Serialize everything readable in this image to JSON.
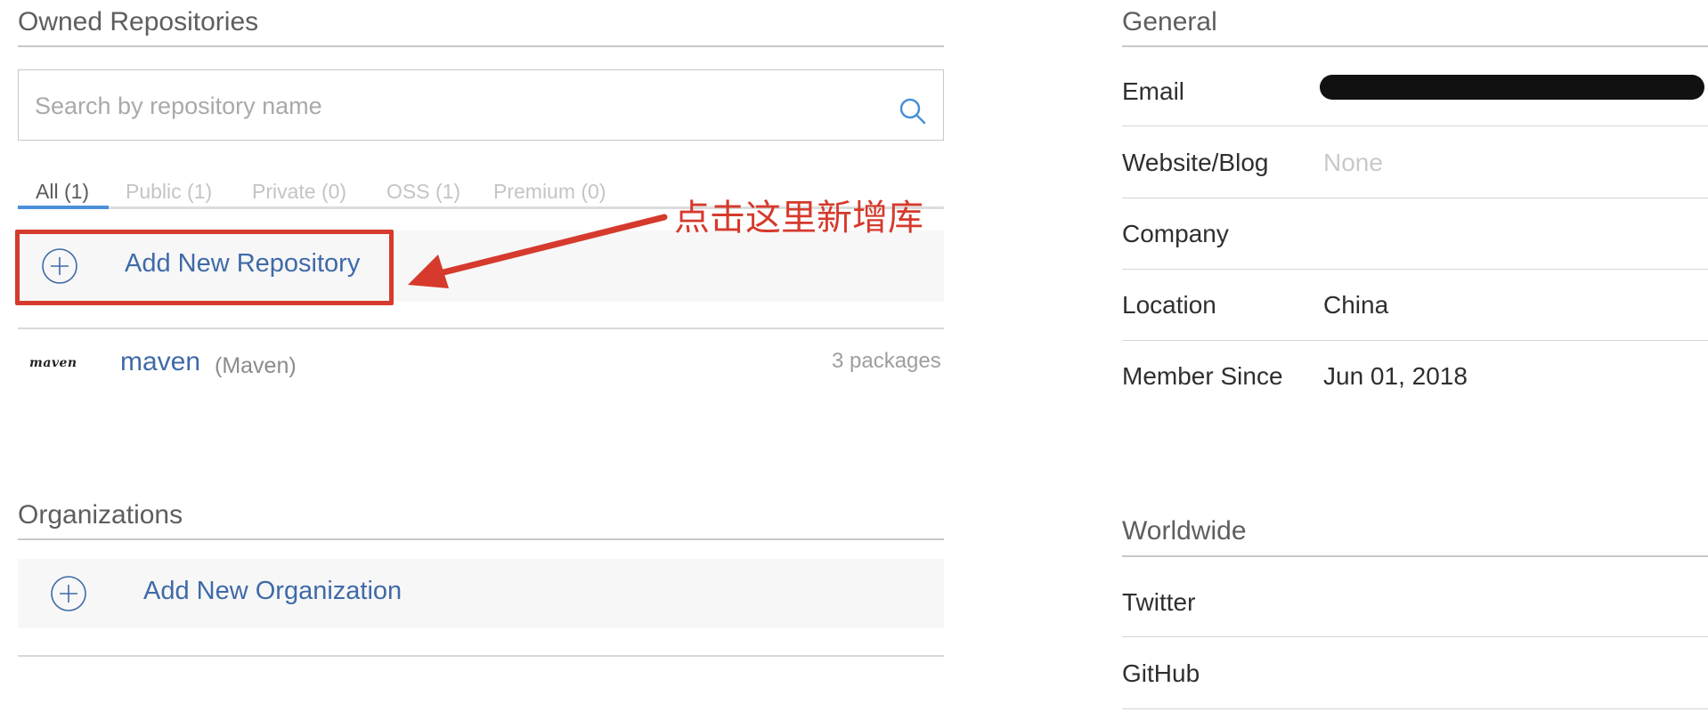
{
  "owned": {
    "title": "Owned Repositories",
    "search_placeholder": "Search by repository name",
    "tabs": [
      {
        "label": "All (1)",
        "active": true
      },
      {
        "label": "Public (1)",
        "active": false
      },
      {
        "label": "Private (0)",
        "active": false
      },
      {
        "label": "OSS (1)",
        "active": false
      },
      {
        "label": "Premium (0)",
        "active": false
      }
    ],
    "add_label": "Add New Repository",
    "repos": [
      {
        "logo": "maven",
        "name": "maven",
        "type": "(Maven)",
        "packages": "3 packages"
      }
    ]
  },
  "annotation": {
    "text": "点击这里新增库",
    "color": "#d53a2c"
  },
  "organizations": {
    "title": "Organizations",
    "add_label": "Add New Organization"
  },
  "general": {
    "title": "General",
    "fields": [
      {
        "label": "Email",
        "value": "",
        "redacted": true
      },
      {
        "label": "Website/Blog",
        "value": "None"
      },
      {
        "label": "Company",
        "value": ""
      },
      {
        "label": "Location",
        "value": "China"
      },
      {
        "label": "Member Since",
        "value": "Jun 01, 2018"
      }
    ]
  },
  "worldwide": {
    "title": "Worldwide",
    "fields": [
      {
        "label": "Twitter"
      },
      {
        "label": "GitHub"
      }
    ]
  },
  "colors": {
    "link": "#3f6aa8",
    "tab_accent": "#4a90d9",
    "highlight": "#d53a2c"
  },
  "icons": {
    "search": "search-icon",
    "add": "plus-circle-icon"
  }
}
